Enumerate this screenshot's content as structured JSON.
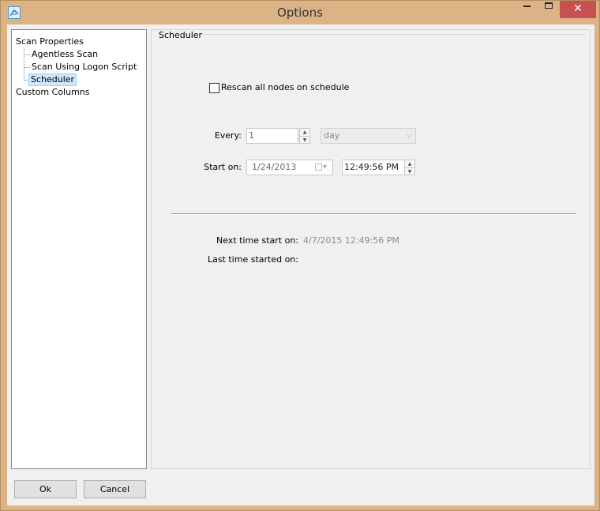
{
  "window": {
    "title": "Options",
    "app_icon": "app-icon",
    "controls": {
      "minimize": "minimize-icon",
      "maximize": "maximize-icon",
      "close": "✕"
    }
  },
  "tree": {
    "root": "Scan Properties",
    "children": [
      "Agentless Scan",
      "Scan Using Logon Script",
      "Scheduler"
    ],
    "selected": "Scheduler",
    "second_root": "Custom Columns"
  },
  "scheduler": {
    "section_title": "Scheduler",
    "rescan_label": "Rescan all nodes on schedule",
    "rescan_checked": false,
    "every_label": "Every:",
    "every_value": "1",
    "unit_value": "day",
    "start_on_label": "Start on:",
    "start_date": "1/24/2013",
    "start_time": "12:49:56 PM",
    "next_time_label": "Next time start on:",
    "next_time_value": "4/7/2015 12:49:56 PM",
    "last_time_label": "Last time started on:",
    "last_time_value": ""
  },
  "buttons": {
    "ok": "Ok",
    "cancel": "Cancel"
  },
  "colors": {
    "frame": "#dcb385",
    "close_button": "#c75050",
    "selection": "#cce8ff",
    "client": "#f0f0f0"
  }
}
